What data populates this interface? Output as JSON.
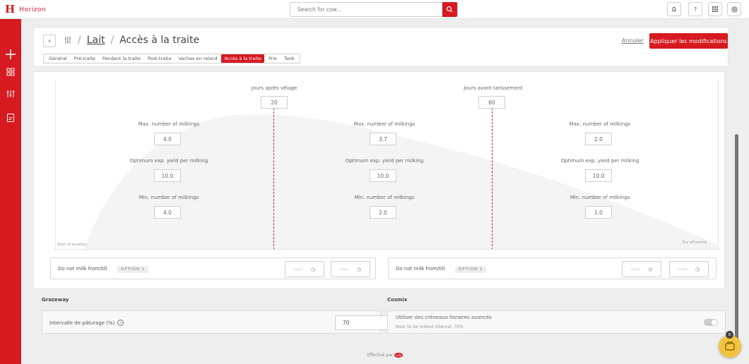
{
  "app": {
    "logo_letter": "H",
    "name": "Horizon"
  },
  "search": {
    "placeholder": "Search for cow..."
  },
  "toolbar": {
    "help_label": "?"
  },
  "header": {
    "breadcrumb_link": "Lait",
    "breadcrumb_sep": "/",
    "page_title": "Accès à la traite",
    "cancel_label": "Annuler",
    "apply_label": "Appliquer les modifications",
    "tabs": [
      "Général",
      "Pré-traite",
      "Pendant la traite",
      "Post-traite",
      "Vaches en retard",
      "Accès à la traite",
      "Prix",
      "Tank"
    ],
    "active_tab": "Accès à la traite"
  },
  "lactation": {
    "days_after_calving_label": "Jours après vêlage",
    "days_after_calving": "20",
    "days_before_dryoff_label": "Jours avant tarissement",
    "days_before_dryoff": "60",
    "max_label": "Max. number of milkings",
    "opt_label": "Optimum exp. yield per milking",
    "min_label": "Min. number of milkings",
    "columns": [
      {
        "max": "4.0",
        "opt": "10.0",
        "min": "4.0"
      },
      {
        "max": "3.7",
        "opt": "10.0",
        "min": "2.0"
      },
      {
        "max": "2.0",
        "opt": "10.0",
        "min": "1.0"
      }
    ],
    "start_label": "Start of lactation",
    "end_label": "Dry off period"
  },
  "do_not_milk": {
    "label": "Do not milk from/till",
    "option1": "OPTION 1",
    "option2": "OPTION 2",
    "time_placeholder": "--:--"
  },
  "grazeway": {
    "title": "Grazeway",
    "field_label": "Intervalle de pâturage (%)",
    "info": "i",
    "value": "70"
  },
  "cosmix": {
    "title": "Cosmix",
    "toggle_label": "Utiliser des créneaux horaires avancés",
    "sub_label": "Near to be milked interval:",
    "sub_value": "70%"
  },
  "footer": {
    "powered_by": "Effectué par",
    "powered_logo": "Lely"
  },
  "fab": {
    "badge": "0"
  },
  "colors": {
    "brand": "#d71920",
    "fab": "#f3c340"
  }
}
